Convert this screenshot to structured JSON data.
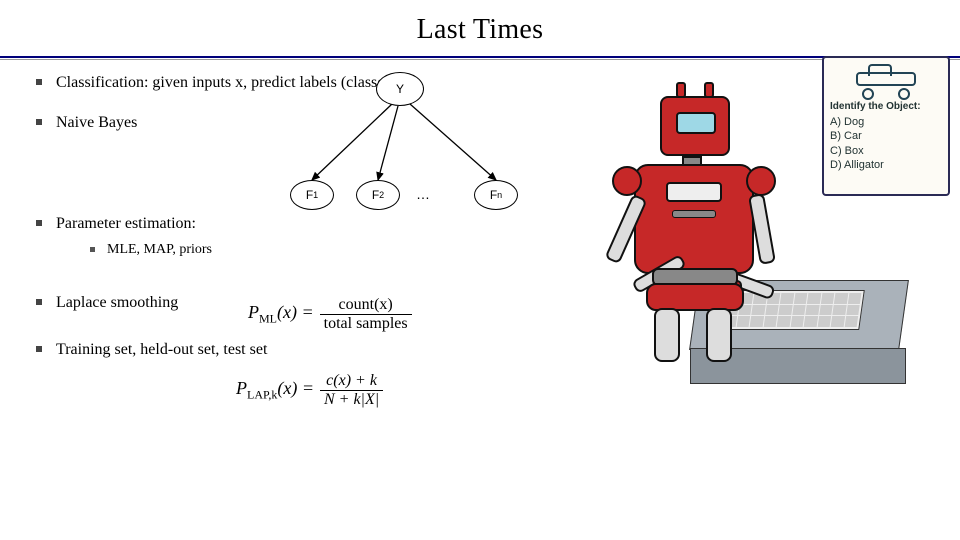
{
  "title": "Last Times",
  "bullets": {
    "b1": "Classification: given inputs x, predict labels (classes) y",
    "b2": "Naive Bayes",
    "b3": "Parameter estimation:",
    "b3s1": "MLE, MAP, priors",
    "b4": "Laplace smoothing",
    "b5": "Training set, held-out set, test set"
  },
  "diagram": {
    "root": "Y",
    "f1a": "F",
    "f1b": "1",
    "f2a": "F",
    "f2b": "2",
    "fna": "F",
    "fnb": "n",
    "dots": "…"
  },
  "formula1": {
    "lhs1": "P",
    "lhs_sub": "ML",
    "lhs2": "(x) =",
    "num": "count(x)",
    "den": "total samples"
  },
  "formula2": {
    "lhs1": "P",
    "lhs_sub": "LAP,k",
    "lhs2": "(x) =",
    "num": "c(x) + k",
    "den": "N + k|X|"
  },
  "whiteboard": {
    "prompt": "Identify the Object:",
    "a": "A) Dog",
    "b": "B) Car",
    "c": "C) Box",
    "d": "D) Alligator"
  }
}
